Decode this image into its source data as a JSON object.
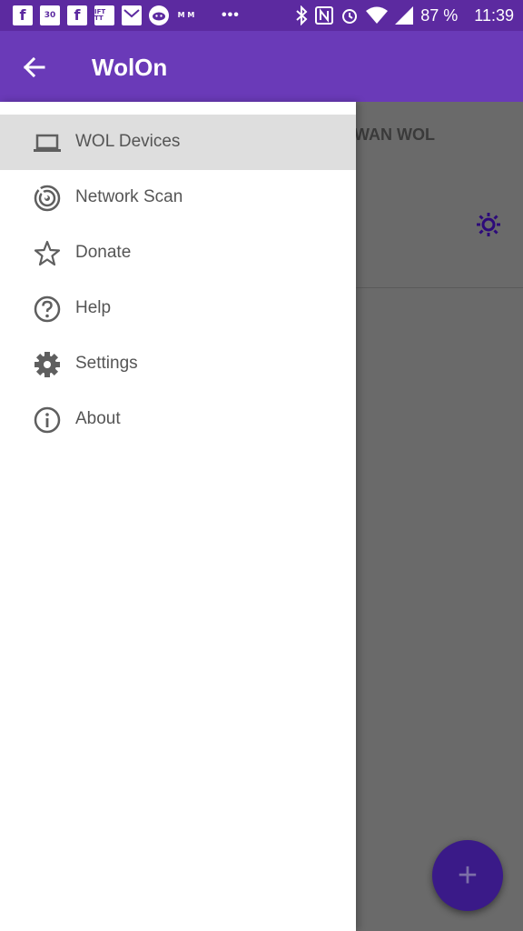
{
  "status_bar": {
    "notification_icons": [
      "facebook-icon",
      "calendar-30-icon",
      "facebook-icon",
      "ifttt-icon",
      "gmail-icon",
      "reddit-icon",
      "mm-icon"
    ],
    "calendar_day": "30",
    "ifttt_label": "IFT TT",
    "mm_label": "M M",
    "overflow": "•••",
    "battery": "87 %",
    "time": "11:39"
  },
  "appbar": {
    "title": "WolOn",
    "color": "#6a3ab8"
  },
  "background": {
    "tab_label": "WAN WOL"
  },
  "drawer": {
    "items": [
      {
        "label": "WOL Devices",
        "icon": "laptop-icon",
        "active": true
      },
      {
        "label": "Network Scan",
        "icon": "radar-icon",
        "active": false
      },
      {
        "label": "Donate",
        "icon": "star-icon",
        "active": false
      },
      {
        "label": "Help",
        "icon": "help-icon",
        "active": false
      },
      {
        "label": "Settings",
        "icon": "gear-icon",
        "active": false
      },
      {
        "label": "About",
        "icon": "info-icon",
        "active": false
      }
    ]
  },
  "fab": {
    "label": "+",
    "icon": "add-icon"
  },
  "colors": {
    "primary": "#6a3ab8",
    "status_bar": "#5c2aa0",
    "fab": "#3a1a88"
  }
}
